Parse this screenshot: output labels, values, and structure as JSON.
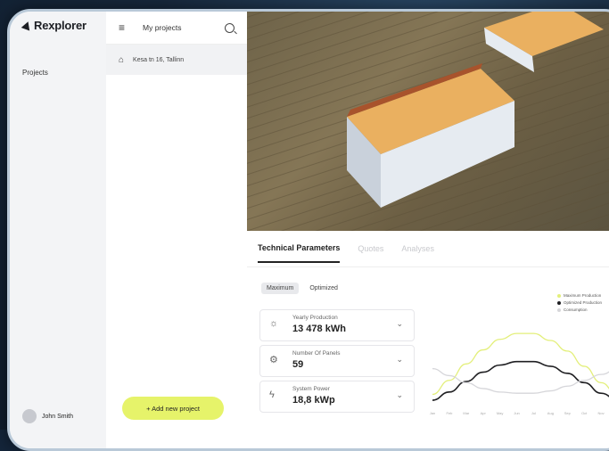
{
  "app": {
    "name": "Rexplorer"
  },
  "nav": {
    "projects_label": "Projects",
    "user_name": "John Smith"
  },
  "projects_panel": {
    "title": "My projects",
    "items": [
      {
        "label": "Kesa tn 16, Tallinn"
      }
    ],
    "add_button": "+ Add new project"
  },
  "tabs": [
    {
      "label": "Technical Parameters",
      "active": true
    },
    {
      "label": "Quotes",
      "active": false
    },
    {
      "label": "Analyses",
      "active": false
    }
  ],
  "mode_toggle": {
    "options": [
      "Maximum",
      "Optimized"
    ],
    "selected": "Maximum"
  },
  "parameters": [
    {
      "label": "Yearly Production",
      "value": "13 478 kWh",
      "icon": "sun-icon"
    },
    {
      "label": "Number Of Panels",
      "value": "59",
      "icon": "gear-icon"
    },
    {
      "label": "System Power",
      "value": "18,8 kWp",
      "icon": "lightning-icon"
    }
  ],
  "colors": {
    "accent": "#e6f36a",
    "max_line": "#e3ef7a",
    "opt_line": "#1f1f22",
    "cons_line": "#d6d6da"
  },
  "chart_data": {
    "type": "line",
    "categories": [
      "Jan",
      "Feb",
      "Mar",
      "Apr",
      "May",
      "Jun",
      "Jul",
      "Aug",
      "Sep",
      "Oct",
      "Nov",
      "Dec"
    ],
    "series": [
      {
        "name": "Maximum Production",
        "values": [
          8,
          20,
          34,
          46,
          55,
          60,
          60,
          54,
          45,
          32,
          18,
          7
        ]
      },
      {
        "name": "Optimized Production",
        "values": [
          3,
          10,
          19,
          27,
          33,
          36,
          36,
          32,
          26,
          18,
          9,
          3
        ]
      },
      {
        "name": "Consumption",
        "values": [
          30,
          24,
          18,
          13,
          10,
          9,
          9,
          11,
          15,
          20,
          25,
          30
        ]
      }
    ],
    "ylim": [
      0,
      70
    ],
    "legend": "top-right",
    "grid": false
  }
}
